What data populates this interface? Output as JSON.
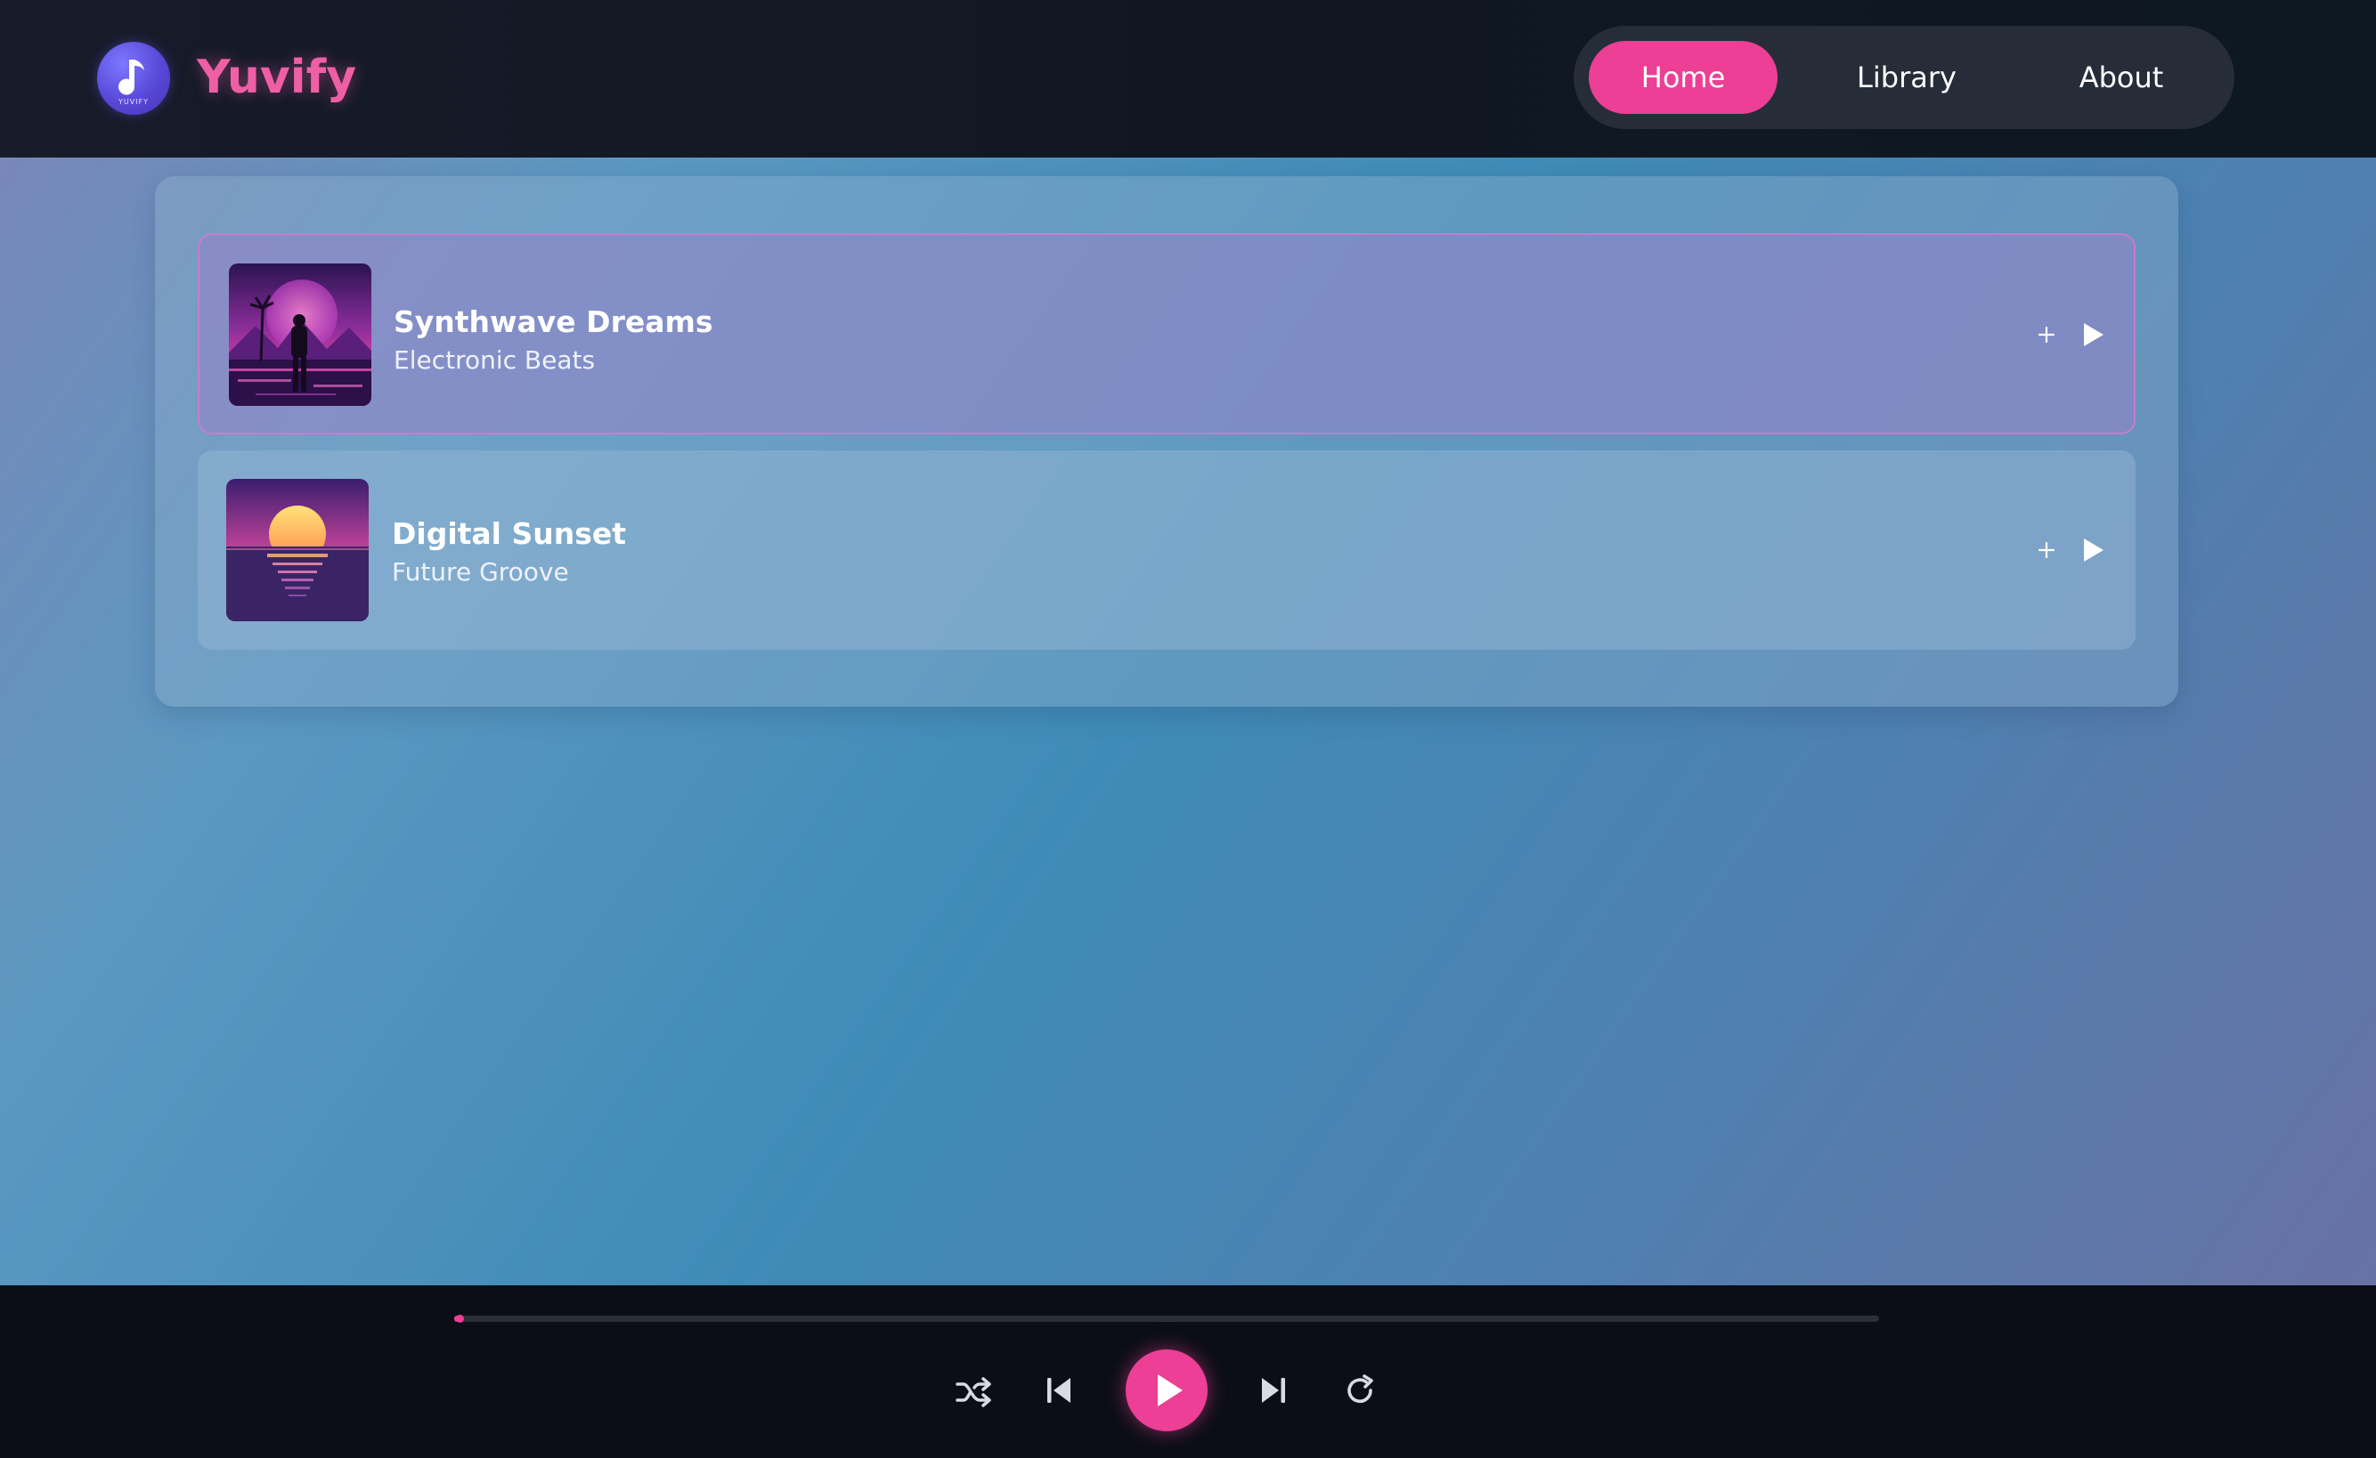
{
  "header": {
    "logo_text": "YUVIFY",
    "brand": "Yuvify",
    "nav": [
      {
        "label": "Home",
        "active": true
      },
      {
        "label": "Library",
        "active": false
      },
      {
        "label": "About",
        "active": false
      }
    ]
  },
  "tracks": [
    {
      "title": "Synthwave Dreams",
      "subtitle": "Electronic Beats",
      "selected": true,
      "add_icon": "plus-icon",
      "play_icon": "play-icon"
    },
    {
      "title": "Digital Sunset",
      "subtitle": "Future Groove",
      "selected": false,
      "add_icon": "plus-icon",
      "play_icon": "play-icon"
    }
  ],
  "player": {
    "progress": 0.004,
    "controls": [
      "shuffle-icon",
      "previous-icon",
      "play-icon",
      "next-icon",
      "repeat-icon"
    ]
  },
  "colors": {
    "accent": "#ec3f95",
    "brand_text": "#ef5fa6",
    "logo": "#5848d8",
    "header_bg": "#121822",
    "player_bg": "#0b0e16"
  }
}
